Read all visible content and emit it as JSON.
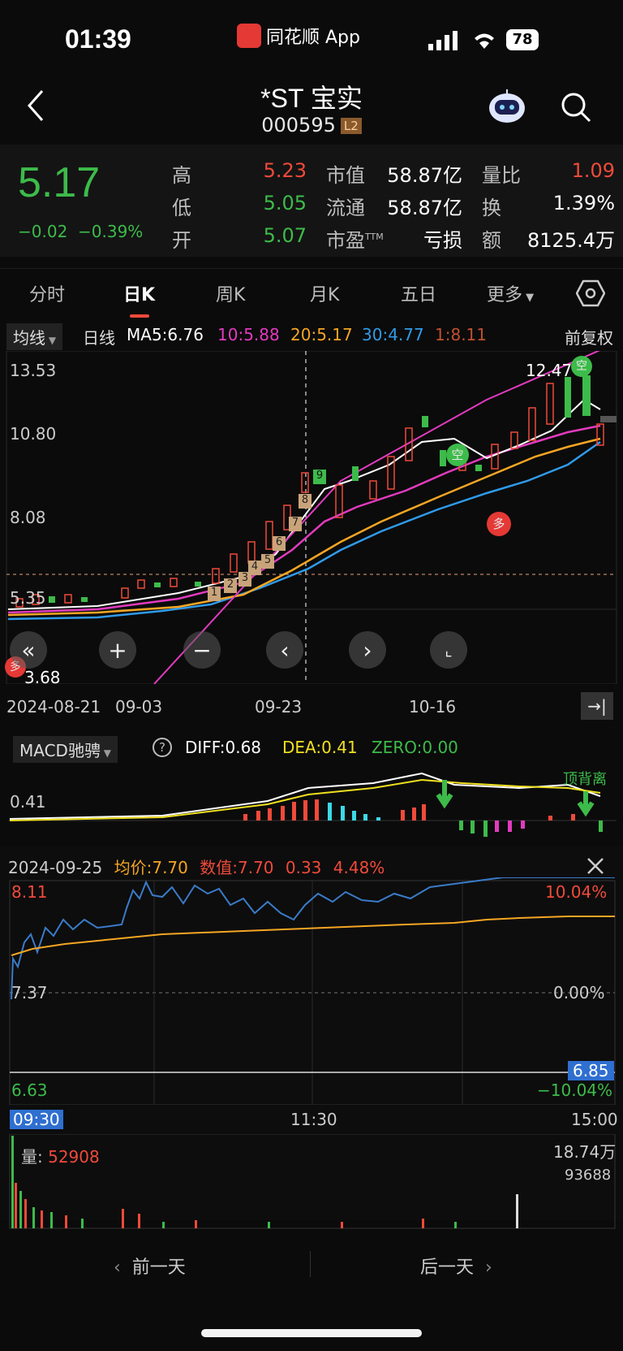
{
  "status_bar": {
    "time": "01:39",
    "app_name": "同花顺 App",
    "battery": "78"
  },
  "header": {
    "title": "*ST 宝实",
    "code": "000595",
    "level_badge": "L2"
  },
  "quote": {
    "price": "5.17",
    "change": "−0.02",
    "change_pct": "−0.39%",
    "high_label": "高",
    "high": "5.23",
    "low_label": "低",
    "low": "5.05",
    "open_label": "开",
    "open": "5.07",
    "mktcap_label": "市值",
    "mktcap": "58.87亿",
    "float_label": "流通",
    "float": "58.87亿",
    "pe_label": "市盈",
    "pe_sup": "TTM",
    "pe": "亏损",
    "volratio_label": "量比",
    "volratio": "1.09",
    "turnover_label": "换",
    "turnover": "1.39%",
    "amount_label": "额",
    "amount": "8125.4万"
  },
  "tabs": [
    "分时",
    "日K",
    "周K",
    "月K",
    "五日",
    "更多"
  ],
  "active_tab": "日K",
  "ma_bar": {
    "selector": "均线",
    "period": "日线",
    "ma5": "MA5:6.76",
    "ma10": "10:5.88",
    "ma20": "20:5.17",
    "ma30": "30:4.77",
    "ma_other": "1:8.11",
    "adjust": "前复权"
  },
  "colors": {
    "up": "#f04a3a",
    "down": "#3dbb4a",
    "ma5": "#ffffff",
    "ma10": "#e23bbf",
    "ma20": "#f5a623",
    "ma30": "#2f9bea",
    "ma_other": "#e0603a",
    "diff": "#ffffff",
    "dea": "#f0e020",
    "zero": "#3dbb4a"
  },
  "kchart": {
    "y_labels": [
      "13.53",
      "10.80",
      "8.08",
      "5.35"
    ],
    "max_label": "12.47",
    "min_label": "3.68",
    "x_labels": [
      "2024-08-21",
      "09-03",
      "09-23",
      "10-16"
    ],
    "signal_up": "多",
    "signal_down": "空",
    "counts": [
      "1",
      "2",
      "3",
      "4",
      "5",
      "6",
      "7",
      "8",
      "9"
    ]
  },
  "macd": {
    "selector": "MACD驰骋",
    "help": "?",
    "diff": "DIFF:0.68",
    "dea": "DEA:0.41",
    "zero": "ZERO:0.00",
    "level": "0.41",
    "annotation": "顶背离"
  },
  "intraday": {
    "date": "2024-09-25",
    "avg_label": "均价:",
    "avg": "7.70",
    "val_label": "数值:",
    "val": "7.70",
    "delta": "0.33",
    "delta_pct": "4.48%",
    "y_top": "8.11",
    "y_mid": "7.37",
    "y_bot": "6.63",
    "pct_top": "10.04%",
    "pct_mid": "0.00%",
    "pct_bot": "−10.04%",
    "cursor_price": "6.85",
    "x_start": "09:30",
    "x_mid": "11:30",
    "x_end": "15:00",
    "vol_label": "量:",
    "vol": "52908",
    "vol_max": "18.74万",
    "vol_mid": "93688"
  },
  "bottom_nav": {
    "prev": "前一天",
    "next": "后一天"
  }
}
